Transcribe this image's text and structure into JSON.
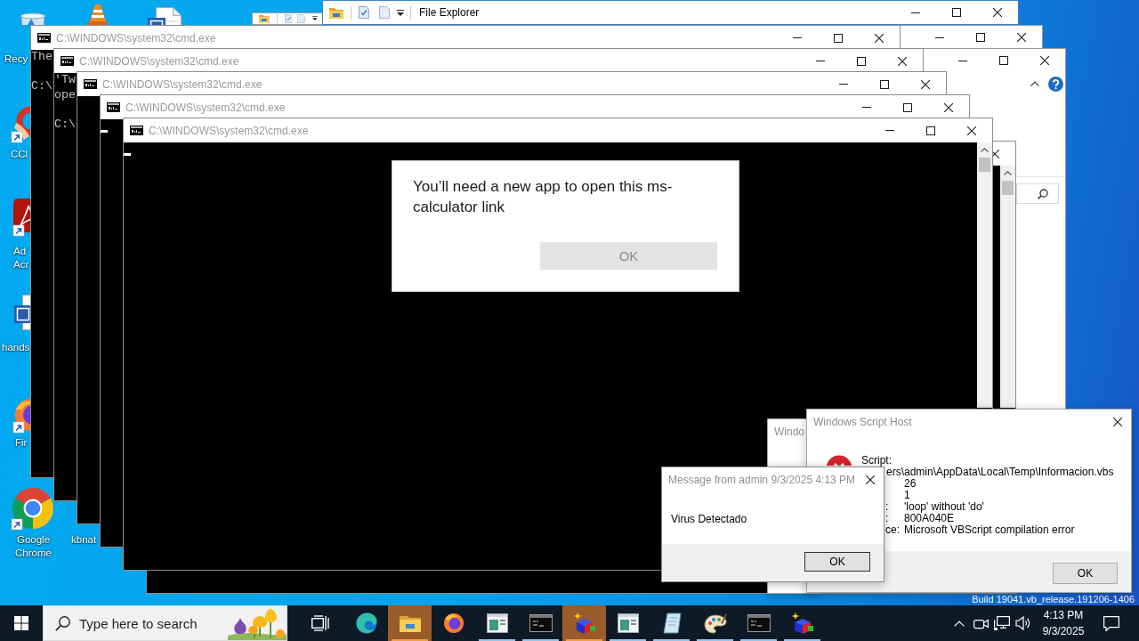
{
  "desktop": {
    "icons": [
      {
        "kind": "recycle-bin",
        "label_lines": [
          "Recy"
        ]
      },
      {
        "kind": "cone"
      },
      {
        "kind": "word-document"
      },
      {
        "kind": "cleaner",
        "label_lines": [
          "CCl"
        ]
      },
      {
        "kind": "pdf-reader",
        "label_lines": [
          "Ad",
          "Acr"
        ]
      },
      {
        "kind": "word-document",
        "label_lines": [
          "hands"
        ]
      },
      {
        "kind": "firefox",
        "label_lines": [
          "Fir"
        ]
      },
      {
        "kind": "chrome",
        "label_lines": [
          "Google",
          "Chrome"
        ]
      },
      {
        "label_lines": [
          "kbnat"
        ]
      }
    ],
    "build_text": "Build 19041.vb_release.191206-1406"
  },
  "explorer_windows": [
    {
      "kind": "quick-access"
    },
    {
      "kind": "quick-access",
      "title": "File Explorer"
    },
    {
      "kind": "plain"
    },
    {
      "kind": "ribbon"
    }
  ],
  "cmd_windows": [
    {
      "title": "C:\\WINDOWS\\system32\\cmd.exe",
      "output": [
        "The"
      ],
      "prompt": "C:\\"
    },
    {
      "title": "C:\\WINDOWS\\system32\\cmd.exe",
      "output": [
        "'Tw",
        "ope"
      ],
      "prompt": "C:\\"
    },
    {
      "title": "C:\\WINDOWS\\system32\\cmd.exe"
    },
    {
      "title": "C:\\WINDOWS\\system32\\cmd.exe",
      "cursor": true
    },
    {
      "title": "C:\\WINDOWS\\system32\\cmd.exe",
      "cursor": true
    }
  ],
  "app_prompt": {
    "message": "You’ll need a new app to open this ms-calculator link",
    "button": "OK"
  },
  "script_host_windows": [
    {
      "title": "Windo"
    },
    {
      "title": "Windows Script Host",
      "script_label": "Script:",
      "script_path": "ers\\admin\\AppData\\Local\\Temp\\Informacion.vbs",
      "fields": [
        {
          "value": "26"
        },
        {
          "value": "1"
        },
        {
          "label": ":",
          "value": "'loop' without 'do'"
        },
        {
          "label": ":",
          "value": "800A040E"
        },
        {
          "label": "ce:",
          "value": "Microsoft VBScript compilation error"
        }
      ],
      "button": "OK"
    }
  ],
  "message_box": {
    "title": "Message from admin 9/3/2025 4:13 PM",
    "text": "Virus Detectado",
    "button": "OK"
  },
  "taskbar": {
    "search": {
      "placeholder": "Type here to search"
    },
    "apps": [
      {
        "kind": "edge",
        "running": false,
        "flashing": false
      },
      {
        "kind": "folder",
        "running": true,
        "flashing": true
      },
      {
        "kind": "firefox",
        "running": false,
        "flashing": false
      },
      {
        "kind": "app-window",
        "running": true,
        "flashing": false
      },
      {
        "kind": "terminal",
        "running": true,
        "flashing": false
      },
      {
        "kind": "cube",
        "running": true,
        "flashing": true
      },
      {
        "kind": "app-window",
        "running": true,
        "flashing": false
      },
      {
        "kind": "notepad",
        "running": true,
        "flashing": false
      },
      {
        "kind": "palette",
        "running": true,
        "flashing": false
      },
      {
        "kind": "terminal",
        "running": true,
        "flashing": false
      },
      {
        "kind": "cube",
        "running": true,
        "flashing": false
      }
    ],
    "clock": {
      "time": "4:13 PM",
      "date": "9/3/2025"
    }
  }
}
